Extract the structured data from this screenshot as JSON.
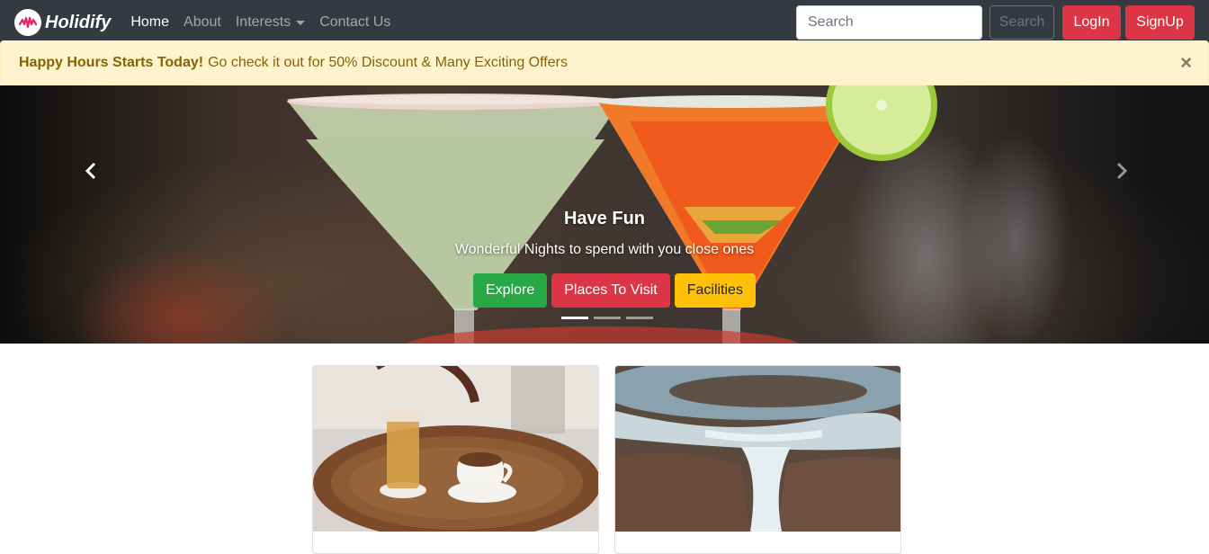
{
  "navbar": {
    "brand": "Holidify",
    "links": [
      {
        "label": "Home",
        "active": true
      },
      {
        "label": "About",
        "active": false
      },
      {
        "label": "Interests",
        "active": false,
        "dropdown": true
      },
      {
        "label": "Contact Us",
        "active": false
      }
    ],
    "search": {
      "placeholder": "Search",
      "value": ""
    },
    "search_button": "Search",
    "login_button": "LogIn",
    "signup_button": "SignUp"
  },
  "alert": {
    "strong": "Happy Hours Starts Today!",
    "text": "Go check it out for 50% Discount & Many Exciting Offers",
    "close": "×"
  },
  "carousel": {
    "caption_title": "Have Fun",
    "caption_text": "Wonderful Nights to spend with you close ones",
    "buttons": [
      "Explore",
      "Places To Visit",
      "Facilities"
    ],
    "slides_count": 3,
    "active_slide": 1
  },
  "cards": [
    {
      "image": "beer-and-coffee-on-barrel-table"
    },
    {
      "image": "waterfall-river-canyon"
    }
  ],
  "colors": {
    "navbar_bg": "#343a40",
    "alert_bg": "#fff3cd",
    "alert_text": "#856404",
    "danger": "#dc3545",
    "success": "#28a745",
    "warning": "#ffc107",
    "brand_accent": "#e0245e"
  },
  "icons": {
    "brand": "holidify-logo-icon",
    "prev": "chevron-left-icon",
    "next": "chevron-right-icon",
    "dropdown": "caret-down-icon"
  }
}
